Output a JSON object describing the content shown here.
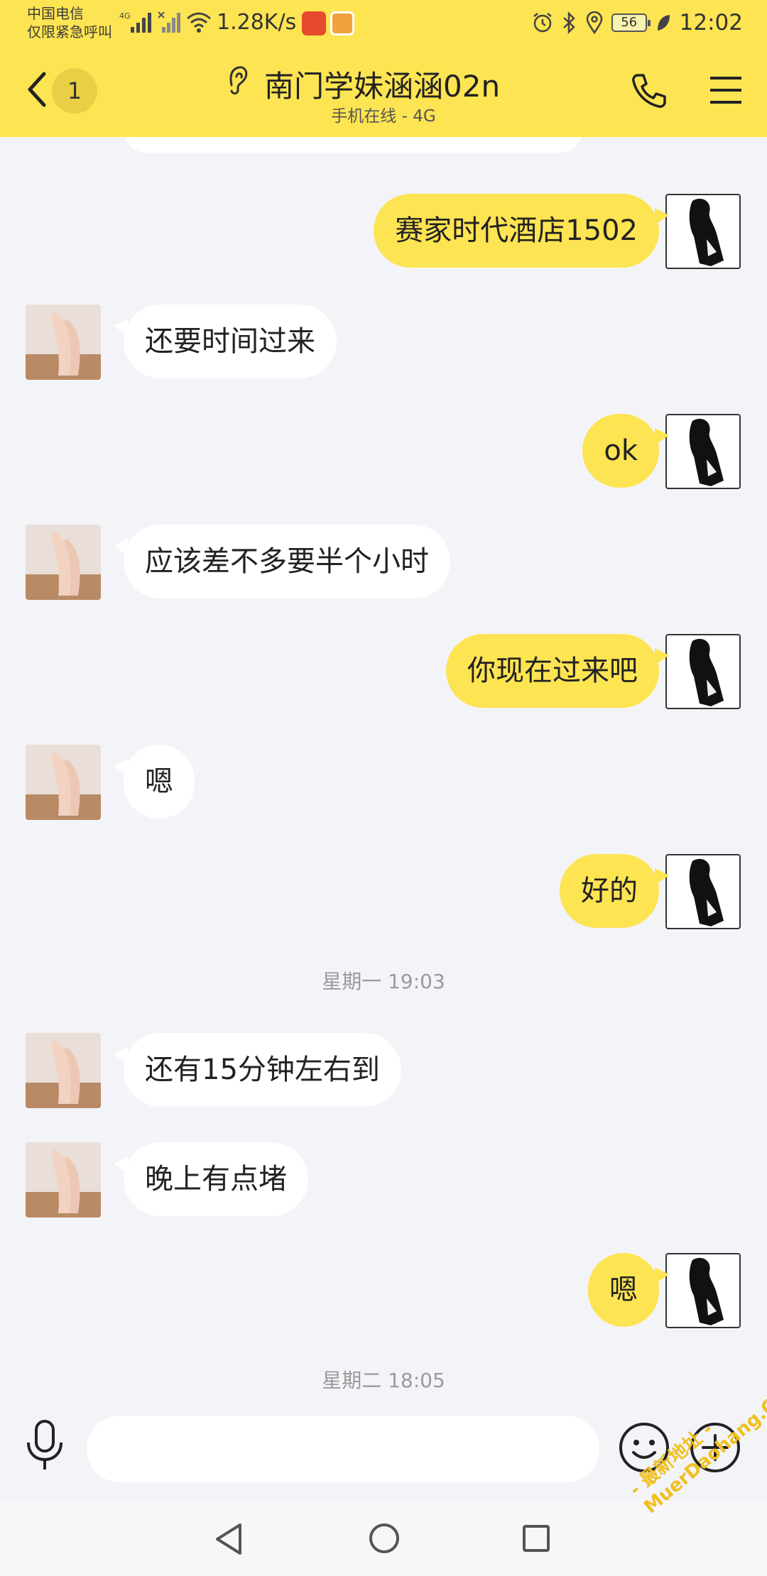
{
  "status_bar": {
    "carrier": "中国电信",
    "emergency_note": "仅限紧急呼叫",
    "network_type": "4G",
    "net_speed": "1.28K/s",
    "battery": "56",
    "time": "12:02",
    "icons": [
      "alarm-icon",
      "bluetooth-icon",
      "location-icon",
      "battery-icon",
      "leaf-icon",
      "wifi-icon",
      "signal-icon"
    ]
  },
  "header": {
    "unread_count": "1",
    "title": "南门学妹涵涵02n",
    "subtitle": "手机在线 - 4G"
  },
  "messages": [
    {
      "from": "me",
      "text": "赛家时代酒店1502"
    },
    {
      "from": "peer",
      "text": "还要时间过来"
    },
    {
      "from": "me",
      "text": "ok"
    },
    {
      "from": "peer",
      "text": "应该差不多要半个小时"
    },
    {
      "from": "me",
      "text": "你现在过来吧"
    },
    {
      "from": "peer",
      "text": "嗯"
    },
    {
      "from": "me",
      "text": "好的"
    },
    {
      "type": "timestamp",
      "text": "星期一 19:03"
    },
    {
      "from": "peer",
      "text": "还有15分钟左右到"
    },
    {
      "from": "peer",
      "text": "晚上有点堵"
    },
    {
      "from": "me",
      "text": "嗯"
    },
    {
      "type": "timestamp",
      "text": "星期二 18:05"
    }
  ],
  "input": {
    "value": "",
    "placeholder": ""
  },
  "watermark": {
    "line1": "- 最新地址 -",
    "line2": "MuerDaohang.Com"
  },
  "colors": {
    "accent": "#fde452",
    "background": "#f3f4f8",
    "bubble_peer": "#ffffff",
    "badge": "#e8cf45"
  }
}
